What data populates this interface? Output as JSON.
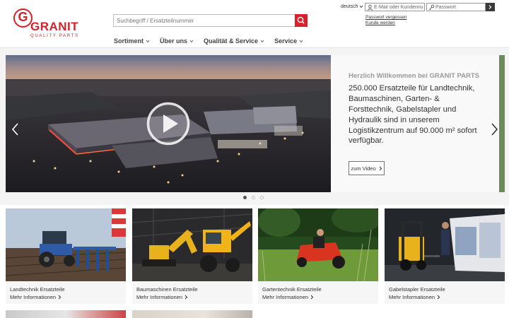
{
  "brand": {
    "logo_letter": "G",
    "logo_word": "GRANIT",
    "logo_tagline": "QUALITY PARTS",
    "accent_color": "#d4212a"
  },
  "header": {
    "search_placeholder": "Suchbegriff / Ersatzteilnummer",
    "language": "deutsch",
    "email_placeholder": "E-Mail oder Kundennu",
    "password_placeholder": "Passwort",
    "forgot_password": "Passwort vergessen",
    "register": "Kunde werden"
  },
  "nav": {
    "items": [
      {
        "label": "Sortiment"
      },
      {
        "label": "Über uns"
      },
      {
        "label": "Qualität & Service"
      },
      {
        "label": "Service"
      }
    ]
  },
  "hero": {
    "kicker": "Herzlich Willkommen bei GRANIT PARTS",
    "text": "250.000 Ersatzteile für Landtechnik, Baumaschinen, Garten- & Forsttechnik, Gabelstapler und Hydraulik sind in unserem Logistikzentrum auf 90.000 m² sofort verfügbar.",
    "button_label": "zum Video",
    "slide_count": 3,
    "active_slide": 1
  },
  "categories": [
    {
      "title": "Landtechnik Ersatzteile",
      "link": "Mehr Informationen"
    },
    {
      "title": "Baumaschinen Ersatzteile",
      "link": "Mehr Informationen"
    },
    {
      "title": "Gartentechnik Ersatzteile",
      "link": "Mehr Informationen"
    },
    {
      "title": "Gabelstapler Ersatzteile",
      "link": "Mehr Informationen"
    }
  ]
}
